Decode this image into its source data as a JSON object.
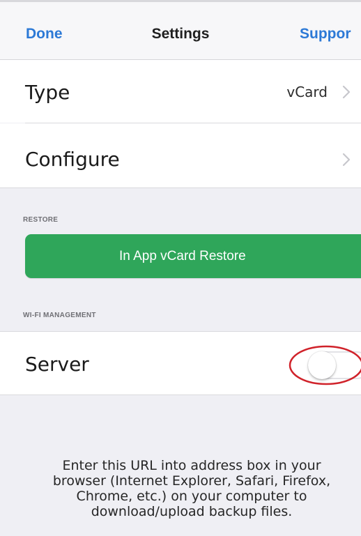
{
  "navbar": {
    "done_label": "Done",
    "title": "Settings",
    "support_label": "Suppor"
  },
  "rows": {
    "type": {
      "label": "Type",
      "value": "vCard"
    },
    "configure": {
      "label": "Configure"
    }
  },
  "restore": {
    "header": "RESTORE",
    "button_label": "In App vCard Restore",
    "button_color": "#2fa65a"
  },
  "wifi": {
    "header": "WI-FI MANAGEMENT",
    "server_label": "Server",
    "server_enabled": false,
    "highlight_color": "#d0222a"
  },
  "footer": {
    "note": "Enter this URL into address box in your browser (Internet Explorer, Safari, Firefox, Chrome, etc.) on your computer to download/upload backup files."
  },
  "colors": {
    "link": "#2c79d6",
    "background": "#efeff4",
    "cell": "#ffffff",
    "chevron": "#c7c7cc"
  }
}
